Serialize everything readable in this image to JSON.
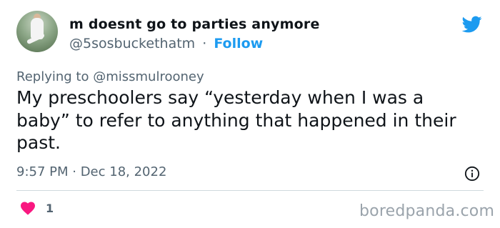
{
  "author": {
    "display_name": "m doesnt go to parties anymore",
    "handle": "@5sosbuckethatm",
    "separator": "·",
    "follow_label": "Follow"
  },
  "reply": {
    "prefix": "Replying to",
    "mention": "@missmulrooney"
  },
  "tweet": {
    "text": "My preschoolers say “yesterday when I was a baby” to refer to anything that happened in their past.",
    "timestamp": "9:57 PM · Dec 18, 2022",
    "like_count": "1"
  },
  "icons": {
    "brand": "twitter-bird-icon",
    "info": "info-icon",
    "like": "heart-icon"
  },
  "colors": {
    "accent": "#1d9bf0",
    "like": "#f91880",
    "secondary_text": "#536471"
  },
  "watermark": "boredpanda.com"
}
